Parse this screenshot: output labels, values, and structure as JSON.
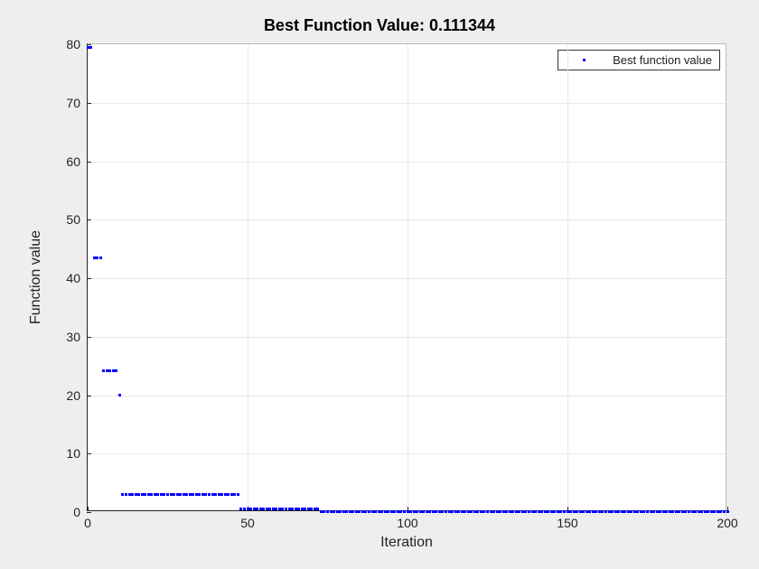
{
  "chart_data": {
    "type": "scatter",
    "title": "Best Function Value: 0.111344",
    "xlabel": "Iteration",
    "ylabel": "Function value",
    "xlim": [
      0,
      200
    ],
    "ylim": [
      0,
      80
    ],
    "xticks": [
      0,
      50,
      100,
      150,
      200
    ],
    "yticks": [
      0,
      10,
      20,
      30,
      40,
      50,
      60,
      70,
      80
    ],
    "legend": {
      "label": "Best function value",
      "position": "northeast"
    },
    "series": [
      {
        "name": "Best function value",
        "color": "#0000ff",
        "marker": ".",
        "plateaus": [
          {
            "x_from": 0,
            "x_to": 1,
            "y": 79.5
          },
          {
            "x_from": 2,
            "x_to": 4,
            "y": 43.5
          },
          {
            "x_from": 5,
            "x_to": 9,
            "y": 24.2
          },
          {
            "x_from": 10,
            "x_to": 10,
            "y": 20.0
          },
          {
            "x_from": 11,
            "x_to": 47,
            "y": 3.0
          },
          {
            "x_from": 48,
            "x_to": 72,
            "y": 0.6
          },
          {
            "x_from": 73,
            "x_to": 200,
            "y": 0.111344
          }
        ]
      }
    ]
  }
}
